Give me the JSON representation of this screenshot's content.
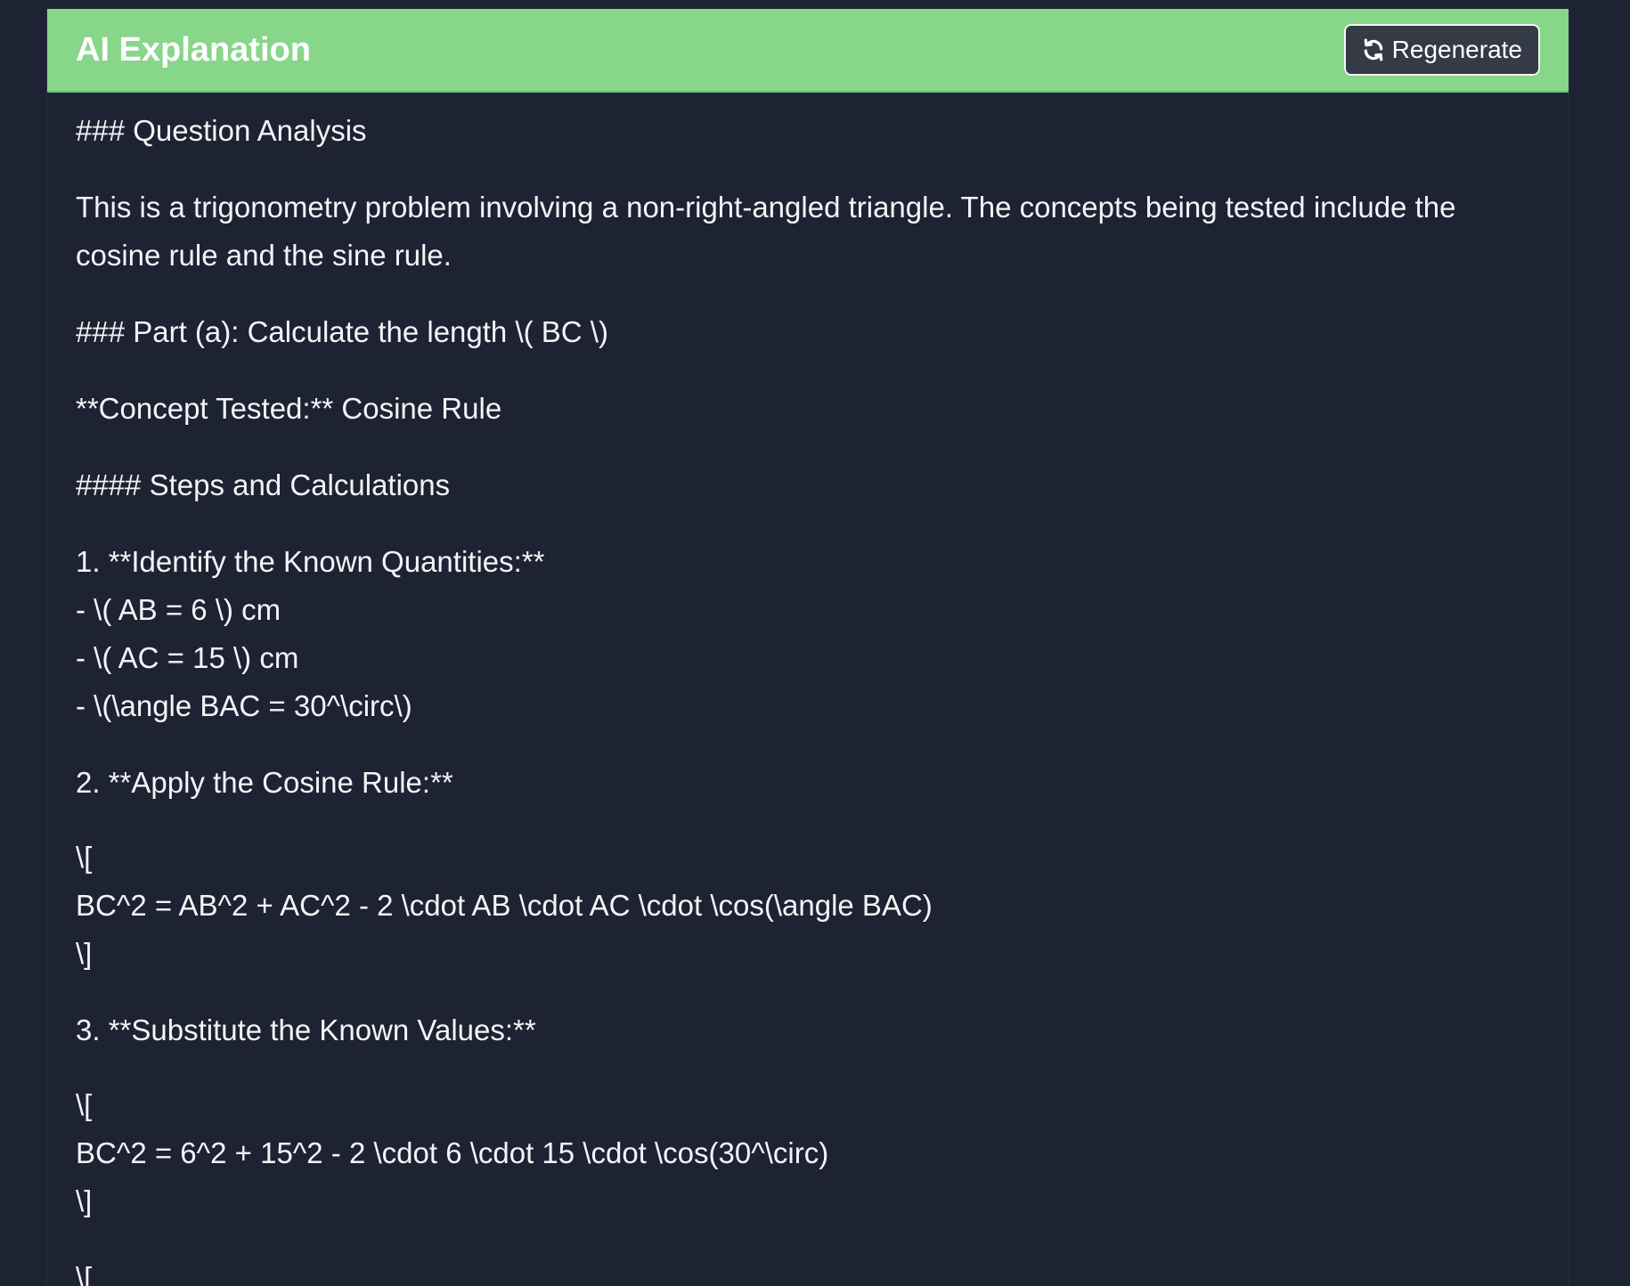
{
  "header": {
    "title": "AI Explanation",
    "regenerate_label": "Regenerate",
    "regenerate_icon": "refresh-icon",
    "background_color": "#88d68a"
  },
  "content": {
    "h_question_analysis": "### Question Analysis",
    "intro_line1": "This is a trigonometry problem involving a non-right-angled triangle. The concepts being tested include the",
    "intro_line2": "cosine rule and the sine rule.",
    "h_part_a": "### Part (a): Calculate the length \\( BC \\)",
    "concept_tested": "**Concept Tested:** Cosine Rule",
    "h_steps": "#### Steps and Calculations",
    "step1_title": "1. **Identify the Known Quantities:**",
    "step1_items": [
      "- \\( AB = 6 \\) cm",
      "- \\( AC = 15 \\) cm",
      "- \\(\\angle BAC = 30^\\circ\\)"
    ],
    "step2_title": "2. **Apply the Cosine Rule:**",
    "formula1": {
      "open": "\\[",
      "body": "BC^2 = AB^2 + AC^2 - 2 \\cdot AB \\cdot AC \\cdot \\cos(\\angle BAC)",
      "close": "\\]"
    },
    "step3_title": "3. **Substitute the Known Values:**",
    "formula2": {
      "open": "\\[",
      "body": "BC^2 = 6^2 + 15^2 - 2 \\cdot 6 \\cdot 15 \\cdot \\cos(30^\\circ)",
      "close": "\\]"
    },
    "trailing_open": "\\["
  }
}
